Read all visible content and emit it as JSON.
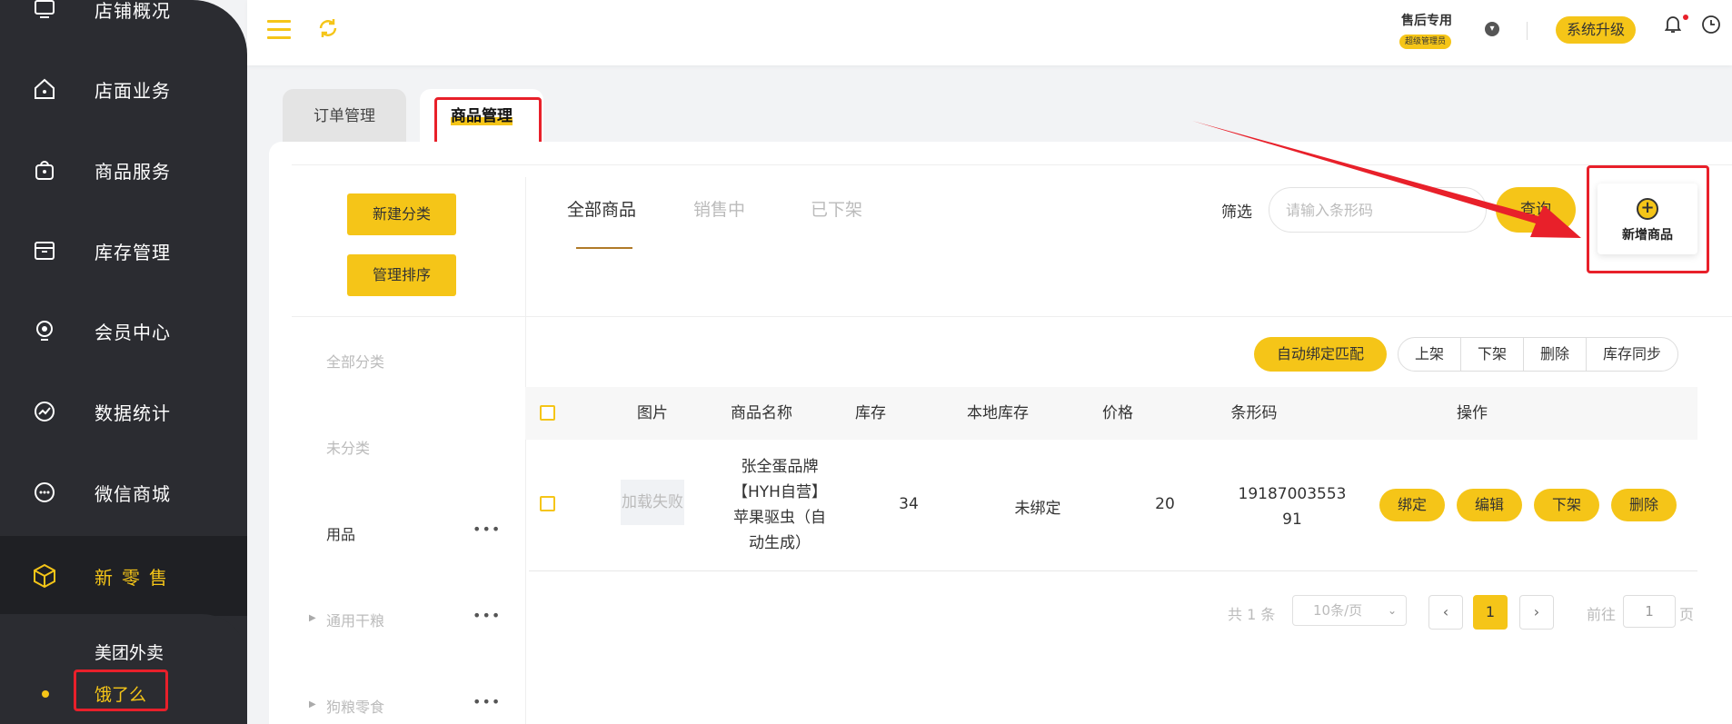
{
  "sidebar": {
    "items": [
      {
        "label": "店铺概况",
        "icon": "monitor-icon"
      },
      {
        "label": "店面业务",
        "icon": "house-icon"
      },
      {
        "label": "商品服务",
        "icon": "bag-icon"
      },
      {
        "label": "库存管理",
        "icon": "box-icon"
      },
      {
        "label": "会员中心",
        "icon": "member-icon"
      },
      {
        "label": "数据统计",
        "icon": "chart-icon"
      },
      {
        "label": "微信商城",
        "icon": "wechat-icon"
      },
      {
        "label": "新零售",
        "icon": "cube-icon"
      }
    ],
    "sub_items": [
      "美团外卖",
      "饿了么"
    ]
  },
  "header": {
    "user_name": "售后专用",
    "user_role": "超级管理员",
    "upgrade_label": "系统升级"
  },
  "tabs": [
    "订单管理",
    "商品管理"
  ],
  "categories": {
    "new_button": "新建分类",
    "sort_button": "管理排序",
    "items": [
      "全部分类",
      "未分类",
      "用品",
      "通用干粮",
      "狗粮零食"
    ],
    "more": "•••"
  },
  "goods_tabs": [
    "全部商品",
    "销售中",
    "已下架"
  ],
  "filter": {
    "label": "筛选",
    "placeholder": "请输入条形码",
    "query_label": "查询"
  },
  "add_goods_label": "新增商品",
  "actions": {
    "auto_bind": "自动绑定匹配",
    "group": [
      "上架",
      "下架",
      "删除",
      "库存同步"
    ]
  },
  "table": {
    "headers": [
      "图片",
      "商品名称",
      "库存",
      "本地库存",
      "价格",
      "条形码",
      "操作"
    ],
    "rows": [
      {
        "image_text": "加载失败",
        "name_lines": [
          "张全蛋品牌",
          "【HYH自营】",
          "苹果驱虫（自",
          "动生成）"
        ],
        "stock": "34",
        "local_stock": "未绑定",
        "price": "20",
        "barcode_lines": [
          "19187003553",
          "91"
        ],
        "buttons": [
          "绑定",
          "编辑",
          "下架",
          "删除"
        ]
      }
    ]
  },
  "pagination": {
    "total": "共 1 条",
    "page_size": "10条/页",
    "current": "1",
    "goto_label": "前往",
    "goto_value": "1",
    "page_unit": "页"
  },
  "colors": {
    "accent": "#f5c518",
    "sidebar": "#2b2c31",
    "annotation": "#e8202a"
  }
}
